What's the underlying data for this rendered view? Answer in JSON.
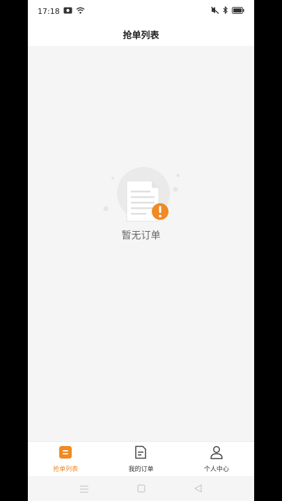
{
  "status_bar": {
    "time": "17:18",
    "icons": [
      "photo-icon",
      "wifi-icon",
      "mute-icon",
      "bluetooth-icon",
      "battery-icon"
    ]
  },
  "header": {
    "title": "抢单列表"
  },
  "empty_state": {
    "message": "暂无订单",
    "icon": "empty-document-icon",
    "accent_color": "#f08a24"
  },
  "tab_bar": {
    "active_color": "#f08a24",
    "items": [
      {
        "label": "抢单列表",
        "icon": "list-icon",
        "active": true
      },
      {
        "label": "我的订单",
        "icon": "order-icon",
        "active": false
      },
      {
        "label": "个人中心",
        "icon": "user-icon",
        "active": false
      }
    ]
  },
  "system_nav": {
    "icons": [
      "menu-icon",
      "home-icon",
      "back-icon"
    ]
  }
}
